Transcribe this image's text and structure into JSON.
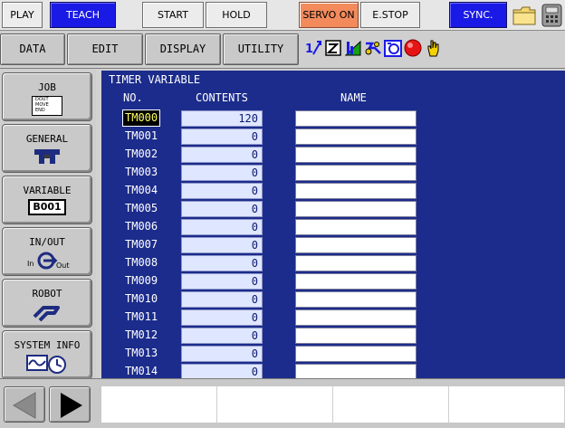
{
  "top": {
    "play": "PLAY",
    "teach": "TEACH",
    "start": "START",
    "hold": "HOLD",
    "servo_on": "SERVO ON",
    "estop": "E.STOP",
    "sync": "SYNC."
  },
  "menu": {
    "data": "DATA",
    "edit": "EDIT",
    "display": "DISPLAY",
    "utility": "UTILITY"
  },
  "main_menu": {
    "job": "JOB",
    "job_icon_text": [
      "DOUT",
      "MOVE",
      "END"
    ],
    "general": "GENERAL",
    "variable": "VARIABLE",
    "variable_icon_text": "B001",
    "inout": "IN/OUT",
    "inout_in": "In",
    "inout_out": "Out",
    "robot": "ROBOT",
    "system_info": "SYSTEM INFO"
  },
  "screen": {
    "title": "TIMER VARIABLE",
    "col_no": "NO.",
    "col_contents": "CONTENTS",
    "col_name": "NAME",
    "rows": [
      {
        "no": "TM000",
        "value": "120",
        "name": ""
      },
      {
        "no": "TM001",
        "value": "0",
        "name": ""
      },
      {
        "no": "TM002",
        "value": "0",
        "name": ""
      },
      {
        "no": "TM003",
        "value": "0",
        "name": ""
      },
      {
        "no": "TM004",
        "value": "0",
        "name": ""
      },
      {
        "no": "TM005",
        "value": "0",
        "name": ""
      },
      {
        "no": "TM006",
        "value": "0",
        "name": ""
      },
      {
        "no": "TM007",
        "value": "0",
        "name": ""
      },
      {
        "no": "TM008",
        "value": "0",
        "name": ""
      },
      {
        "no": "TM009",
        "value": "0",
        "name": ""
      },
      {
        "no": "TM010",
        "value": "0",
        "name": ""
      },
      {
        "no": "TM011",
        "value": "0",
        "name": ""
      },
      {
        "no": "TM012",
        "value": "0",
        "name": ""
      },
      {
        "no": "TM013",
        "value": "0",
        "name": ""
      },
      {
        "no": "TM014",
        "value": "0",
        "name": ""
      }
    ]
  },
  "icons": {
    "status": [
      "coordinate-icon",
      "step-icon",
      "speed-icon",
      "pose-icon",
      "cycle-icon",
      "running-lamp-icon",
      "hand-icon"
    ],
    "folder": "folder-icon",
    "pendant": "pendant-icon"
  },
  "colors": {
    "teach_blue": "#1a1ae6",
    "servo_orange": "#f28a5c",
    "screen_blue": "#1c2c8c",
    "cell_blue": "#dfe6ff"
  }
}
